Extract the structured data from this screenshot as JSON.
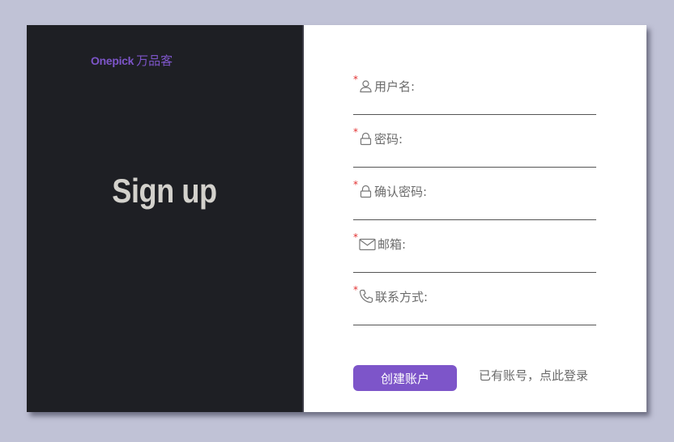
{
  "brand": {
    "latin": "Onepick",
    "cjk": "万品客"
  },
  "left_panel": {
    "title": "Sign up"
  },
  "form": {
    "fields": [
      {
        "label": "用户名:",
        "icon": "user-icon",
        "required_mark": "*",
        "value": ""
      },
      {
        "label": "密码:",
        "icon": "lock-icon",
        "required_mark": "*",
        "value": ""
      },
      {
        "label": "确认密码:",
        "icon": "lock-icon",
        "required_mark": "*",
        "value": ""
      },
      {
        "label": "邮箱:",
        "icon": "mail-icon",
        "required_mark": "*",
        "value": ""
      },
      {
        "label": "联系方式:",
        "icon": "phone-icon",
        "required_mark": "*",
        "value": ""
      }
    ],
    "submit_label": "创建账户",
    "login_link": "已有账号，点此登录"
  },
  "colors": {
    "page_background": "#c0c2d6",
    "left_panel": "#1e1f24",
    "accent": "#7d55c9",
    "title_text": "#d3d1cc",
    "required": "#e23131",
    "label_text": "#6b6b6b"
  }
}
